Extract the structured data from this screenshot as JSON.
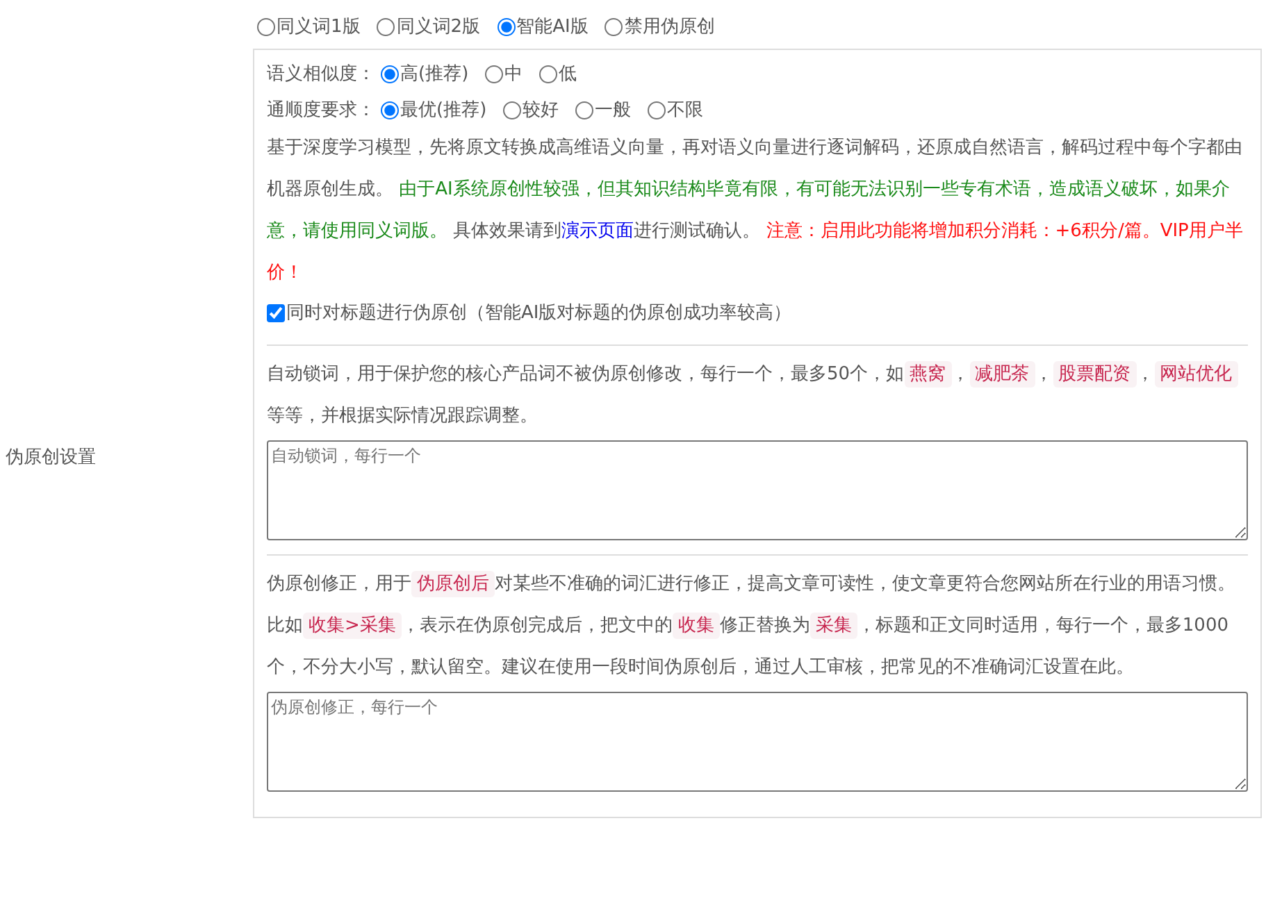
{
  "label": "伪原创设置",
  "modes": [
    {
      "label": "同义词1版",
      "selected": false
    },
    {
      "label": "同义词2版",
      "selected": false
    },
    {
      "label": "智能AI版",
      "selected": true
    },
    {
      "label": "禁用伪原创",
      "selected": false
    }
  ],
  "options": [
    {
      "label": "语义相似度：",
      "choices": [
        {
          "label": "高(推荐)",
          "selected": true
        },
        {
          "label": "中",
          "selected": false
        },
        {
          "label": "低",
          "selected": false
        }
      ]
    },
    {
      "label": "通顺度要求：",
      "choices": [
        {
          "label": "最优(推荐)",
          "selected": true
        },
        {
          "label": "较好",
          "selected": false
        },
        {
          "label": "一般",
          "selected": false
        },
        {
          "label": "不限",
          "selected": false
        }
      ]
    }
  ],
  "description": [
    {
      "kind": "text",
      "text": "基于深度学习模型，先将原文转换成高维语义向量，再对语义向量进行逐词解码，还原成自然语言，解码过程中每个字都由机器原创生成。 "
    },
    {
      "kind": "note",
      "text": "由于AI系统原创性较强，但其知识结构毕竟有限，有可能无法识别一些专有术语，造成语义破坏，如果介意，请使用同义词版。"
    },
    {
      "kind": "text",
      "text": " 具体效果请到"
    },
    {
      "kind": "link",
      "text": "演示页面"
    },
    {
      "kind": "text",
      "text": "进行测试确认。 "
    },
    {
      "kind": "warning",
      "text": "注意：启用此功能将增加积分消耗：+6积分/篇。VIP用户半价！"
    }
  ],
  "title_option": {
    "label": "同时对标题进行伪原创（智能AI版对标题的伪原创成功率较高）",
    "checked": true
  },
  "sections": [
    {
      "description": [
        {
          "kind": "text",
          "text": "自动锁词，用于保护您的核心产品词不被伪原创修改，每行一个，最多50个，如"
        },
        {
          "kind": "tag",
          "text": "燕窝"
        },
        {
          "kind": "text",
          "text": "，"
        },
        {
          "kind": "tag",
          "text": "减肥茶"
        },
        {
          "kind": "text",
          "text": "，"
        },
        {
          "kind": "tag",
          "text": "股票配资"
        },
        {
          "kind": "text",
          "text": "，"
        },
        {
          "kind": "tag",
          "text": "网站优化"
        },
        {
          "kind": "text",
          "text": " 等等，并根据实际情况跟踪调整。"
        }
      ],
      "placeholder": "自动锁词，每行一个"
    },
    {
      "description": [
        {
          "kind": "text",
          "text": "伪原创修正，用于"
        },
        {
          "kind": "tag",
          "text": "伪原创后"
        },
        {
          "kind": "text",
          "text": "对某些不准确的词汇进行修正，提高文章可读性，使文章更符合您网站所在行业的用语习惯。比如"
        },
        {
          "kind": "tag",
          "text": "收集>采集"
        },
        {
          "kind": "text",
          "text": "，表示在伪原创完成后，把文中的"
        },
        {
          "kind": "tag",
          "text": "收集"
        },
        {
          "kind": "text",
          "text": "修正替换为"
        },
        {
          "kind": "tag",
          "text": "采集"
        },
        {
          "kind": "text",
          "text": "，标题和正文同时适用，每行一个，最多1000个，不分大小写，默认留空。建议在使用一段时间伪原创后，通过人工审核，把常见的不准确词汇设置在此。"
        }
      ],
      "placeholder": "伪原创修正，每行一个"
    }
  ]
}
